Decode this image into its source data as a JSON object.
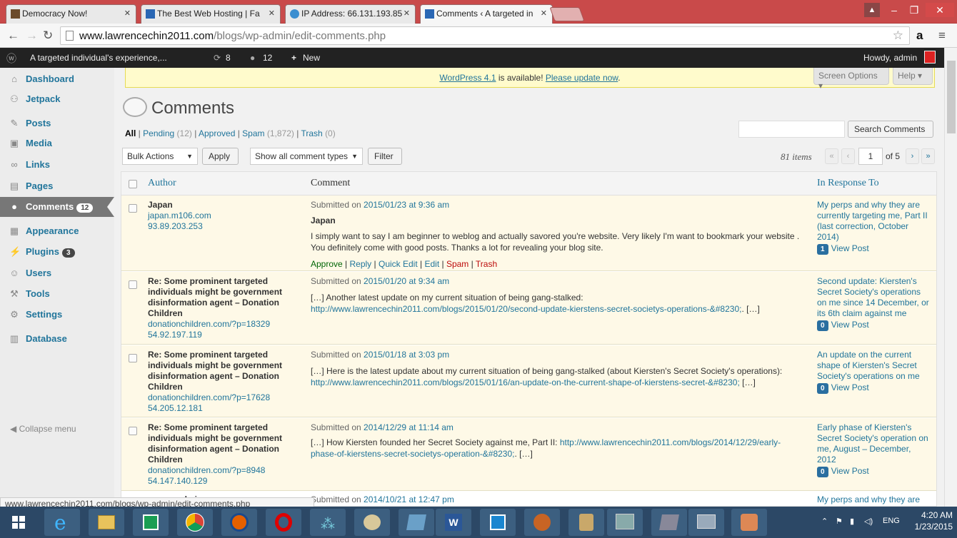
{
  "browser": {
    "tabs": [
      {
        "label": "Democracy Now!"
      },
      {
        "label": "The Best Web Hosting | Fa"
      },
      {
        "label": "IP Address: 66.131.193.85"
      },
      {
        "label": "Comments ‹ A targeted in"
      }
    ],
    "url_host": "www.lawrencechin2011.com",
    "url_path": "/blogs/wp-admin/edit-comments.php",
    "status_url": "www.lawrencechin2011.com/blogs/wp-admin/edit-comments.php"
  },
  "adminbar": {
    "site": "A targeted individual's experience,...",
    "updates": "8",
    "comments": "12",
    "new": "New",
    "howdy": "Howdy, admin"
  },
  "sidebar": {
    "items": [
      {
        "label": "Dashboard",
        "icon": "⌂"
      },
      {
        "label": "Jetpack",
        "icon": "⚇"
      },
      {
        "label": "Posts",
        "icon": "✎"
      },
      {
        "label": "Media",
        "icon": "▣"
      },
      {
        "label": "Links",
        "icon": "∞"
      },
      {
        "label": "Pages",
        "icon": "▤"
      },
      {
        "label": "Comments",
        "icon": "●",
        "badge": "12"
      },
      {
        "label": "Appearance",
        "icon": "▦"
      },
      {
        "label": "Plugins",
        "icon": "⚡",
        "badge": "3"
      },
      {
        "label": "Users",
        "icon": "☺"
      },
      {
        "label": "Tools",
        "icon": "⚒"
      },
      {
        "label": "Settings",
        "icon": "⚙"
      },
      {
        "label": "Database",
        "icon": "▥"
      }
    ],
    "collapse": "Collapse menu"
  },
  "notice": {
    "version_link": "WordPress 4.1",
    "text": " is available! ",
    "update_link": "Please update now",
    "end": "."
  },
  "screen_options": "Screen Options ▾",
  "help": "Help ▾",
  "page_title": "Comments",
  "filters": {
    "all": "All",
    "pending": "Pending",
    "pending_count": "(12)",
    "approved": "Approved",
    "spam": "Spam",
    "spam_count": "(1,872)",
    "trash": "Trash",
    "trash_count": "(0)"
  },
  "search_button": "Search Comments",
  "bulk_actions": "Bulk Actions",
  "apply": "Apply",
  "comment_types": "Show all comment types",
  "filter": "Filter",
  "items_count": "81 items",
  "pagination": {
    "first": "«",
    "prev": "‹",
    "current": "1",
    "of": "of 5",
    "next": "›",
    "last": "»"
  },
  "table": {
    "col_author": "Author",
    "col_comment": "Comment",
    "col_response": "In Response To",
    "rows": [
      {
        "author": "Japan",
        "site": "japan.m106.com",
        "ip": "93.89.203.253",
        "submitted_prefix": "Submitted on ",
        "date": "2015/01/23 at 9:36 am",
        "title": "Japan",
        "text": "I simply want to say I am beginner to weblog and actually savored you're website. Very likely I'm want to bookmark your website . You definitely come with good posts. Thanks a lot for revealing your blog site.",
        "actions": {
          "approve": "Approve",
          "reply": "Reply",
          "quick_edit": "Quick Edit",
          "edit": "Edit",
          "spam": "Spam",
          "trash": "Trash"
        },
        "response": "My perps and why they are currently targeting me, Part II (last correction, October 2014)",
        "count": "1",
        "view": "View Post"
      },
      {
        "author": "Re: Some prominent targeted individuals might be government disinformation agent – Donation Children",
        "site": "donationchildren.com/?p=18329",
        "ip": "54.92.197.119",
        "submitted_prefix": "Submitted on ",
        "date": "2015/01/20 at 9:34 am",
        "text": "[…] Another latest update on my current situation of being gang-stalked: ",
        "text_link": "http://www.lawrencechin2011.com/blogs/2015/01/20/second-update-kierstens-secret-societys-operations-&#8230;",
        "text_end": ". […]",
        "response": "Second update: Kiersten's Secret Society's operations on me since 14 December, or its 6th claim against me",
        "count": "0",
        "view": "View Post"
      },
      {
        "author": "Re: Some prominent targeted individuals might be government disinformation agent – Donation Children",
        "site": "donationchildren.com/?p=17628",
        "ip": "54.205.12.181",
        "submitted_prefix": "Submitted on ",
        "date": "2015/01/18 at 3:03 pm",
        "text": "[…] Here is the latest update about my current situation of being gang-stalked (about Kiersten's Secret Society's operations): ",
        "text_link": "http://www.lawrencechin2011.com/blogs/2015/01/16/an-update-on-the-current-shape-of-kierstens-secret-&#8230;",
        "text_end": " […]",
        "response": "An update on the current shape of Kiersten's Secret Society's operations on me",
        "count": "0",
        "view": "View Post"
      },
      {
        "author": "Re: Some prominent targeted individuals might be government disinformation agent – Donation Children",
        "site": "donationchildren.com/?p=8948",
        "ip": "54.147.140.129",
        "submitted_prefix": "Submitted on ",
        "date": "2014/12/29 at 11:14 am",
        "text": "[…] How Kiersten founded her Secret Society against me, Part II: ",
        "text_link": "http://www.lawrencechin2011.com/blogs/2014/12/29/early-phase-of-kierstens-secret-societys-operation-&#8230;",
        "text_end": ". […]",
        "response": "Early phase of Kiersten's Secret Society's operation on me, August – December, 2012",
        "count": "0",
        "view": "View Post"
      },
      {
        "author": "admin",
        "submitted_prefix": "Submitted on ",
        "date": "2014/10/21 at 12:47 pm",
        "response": "My perps and why they are currently targeting me, Part II"
      }
    ]
  },
  "tray": {
    "lang": "ENG",
    "time": "4:20 AM",
    "date": "1/23/2015"
  },
  "colors": {
    "wp_link": "#21759b",
    "admin_bar": "#222222",
    "chrome_tabbar": "#c94a4a",
    "taskbar": "#2c4866",
    "pending_row": "#fef9e7"
  }
}
